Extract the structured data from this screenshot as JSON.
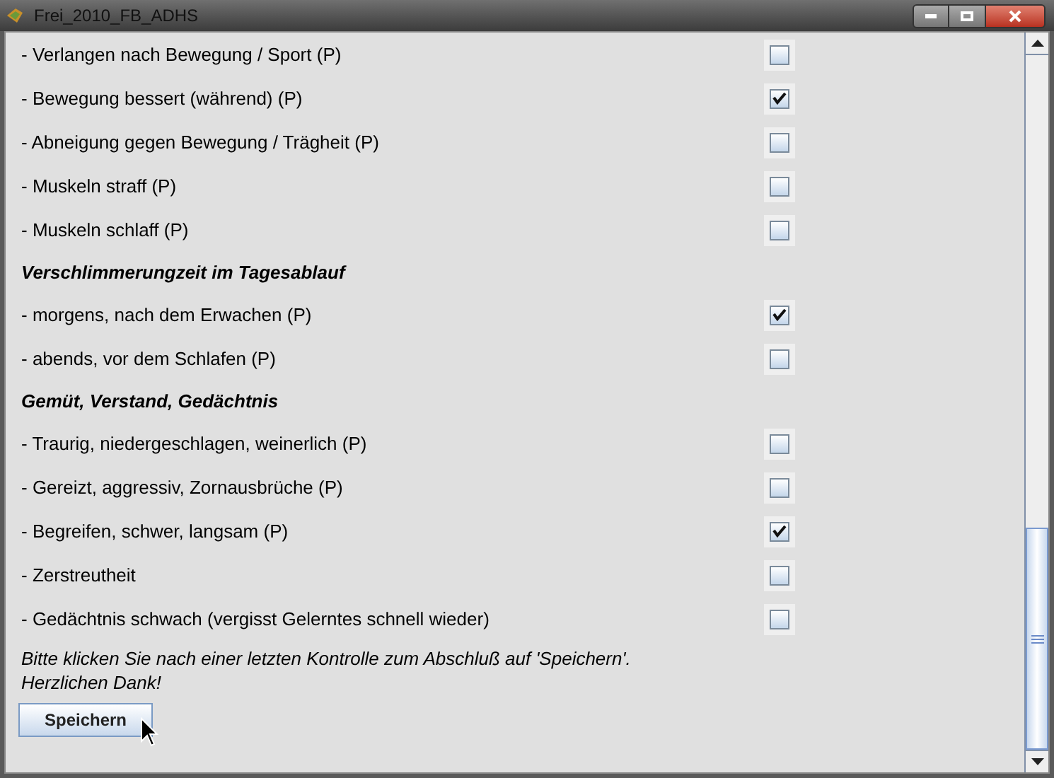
{
  "window": {
    "title": "Frei_2010_FB_ADHS"
  },
  "items": [
    {
      "kind": "checkbox",
      "label": "- Verlangen nach Bewegung / Sport (P)",
      "checked": false
    },
    {
      "kind": "checkbox",
      "label": "- Bewegung bessert (während) (P)",
      "checked": true
    },
    {
      "kind": "checkbox",
      "label": "- Abneigung gegen Bewegung / Trägheit (P)",
      "checked": false
    },
    {
      "kind": "checkbox",
      "label": "- Muskeln straff (P)",
      "checked": false
    },
    {
      "kind": "checkbox",
      "label": "- Muskeln schlaff (P)",
      "checked": false
    },
    {
      "kind": "heading",
      "label": "Verschlimmerungzeit im Tagesablauf"
    },
    {
      "kind": "checkbox",
      "label": "- morgens, nach dem Erwachen (P)",
      "checked": true
    },
    {
      "kind": "checkbox",
      "label": "- abends, vor dem Schlafen (P)",
      "checked": false
    },
    {
      "kind": "heading",
      "label": "Gemüt, Verstand, Gedächtnis"
    },
    {
      "kind": "checkbox",
      "label": "- Traurig, niedergeschlagen, weinerlich (P)",
      "checked": false
    },
    {
      "kind": "checkbox",
      "label": "- Gereizt, aggressiv, Zornausbrüche (P)",
      "checked": false
    },
    {
      "kind": "checkbox",
      "label": "- Begreifen, schwer, langsam (P)",
      "checked": true
    },
    {
      "kind": "checkbox",
      "label": "- Zerstreutheit",
      "checked": false
    },
    {
      "kind": "checkbox",
      "label": "- Gedächtnis schwach (vergisst Gelerntes schnell wieder)",
      "checked": false
    }
  ],
  "note": [
    "Bitte klicken Sie nach einer letzten Kontrolle zum Abschluß auf 'Speichern'.",
    "Herzlichen Dank!"
  ],
  "save_button": "Speichern"
}
